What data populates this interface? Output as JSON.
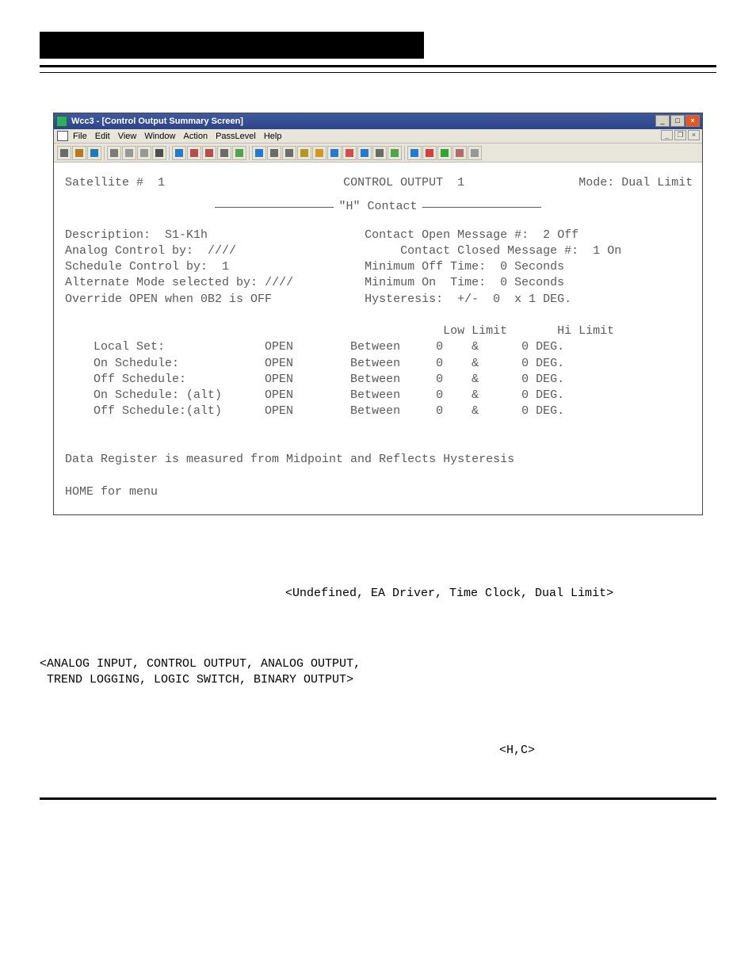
{
  "window": {
    "title": "Wcc3 - [Control Output Summary Screen]",
    "menus": [
      "File",
      "Edit",
      "View",
      "Window",
      "Action",
      "PassLevel",
      "Help"
    ],
    "mdi_buttons": {
      "min": "_",
      "restore": "❐",
      "close": "×"
    },
    "win_buttons": {
      "min": "_",
      "max": "□",
      "close": "×"
    }
  },
  "toolbar_icons": [
    "new-icon",
    "open-icon",
    "save-icon",
    "cut-icon",
    "copy-icon",
    "paste-icon",
    "print-icon",
    "help-icon",
    "book-icon",
    "book2-icon",
    "find-icon",
    "t1-icon",
    "filter-icon",
    "host-icon",
    "tree-icon",
    "hourglass-icon",
    "star-icon",
    "wand-icon",
    "gear-icon",
    "link-icon",
    "grid-icon",
    "doc-icon",
    "info-icon",
    "stop-icon",
    "play-icon",
    "person-icon",
    "tool-icon"
  ],
  "screen": {
    "satellite_label": "Satellite #",
    "satellite_no": "1",
    "control_output_label": "CONTROL OUTPUT",
    "control_output_no": "1",
    "mode_label": "Mode:",
    "mode_value": "Dual Limit",
    "h_contact": "\"H\" Contact",
    "left": {
      "description_label": "Description:",
      "description_value": "S1-K1h",
      "analog_control_label": "Analog Control by:",
      "analog_control_value": "////",
      "schedule_control_label": "Schedule Control by:",
      "schedule_control_value": "1",
      "alt_mode_label": "Alternate Mode selected by:",
      "alt_mode_value": "////",
      "override_line": "Override OPEN when 0B2 is OFF"
    },
    "right": {
      "open_msg_label": "Contact Open Message #:",
      "open_msg_no": "2",
      "open_msg_text": "Off",
      "closed_msg_label": "Contact Closed Message #:",
      "closed_msg_no": "1",
      "closed_msg_text": "On",
      "min_off_label": "Minimum Off Time:",
      "min_off_value": "0 Seconds",
      "min_on_label": "Minimum On  Time:",
      "min_on_value": "0 Seconds",
      "hyst_label": "Hysteresis:  +/-",
      "hyst_value": "0  x 1 DEG."
    },
    "limits": {
      "low_hdr": "Low Limit",
      "hi_hdr": "Hi Limit",
      "rows": [
        {
          "label": "Local Set:",
          "state": "OPEN",
          "between": "Between",
          "low": "0",
          "amp": "&",
          "hi": "0",
          "unit": "DEG."
        },
        {
          "label": "On Schedule:",
          "state": "OPEN",
          "between": "Between",
          "low": "0",
          "amp": "&",
          "hi": "0",
          "unit": "DEG."
        },
        {
          "label": "Off Schedule:",
          "state": "OPEN",
          "between": "Between",
          "low": "0",
          "amp": "&",
          "hi": "0",
          "unit": "DEG."
        },
        {
          "label": "On Schedule: (alt)",
          "state": "OPEN",
          "between": "Between",
          "low": "0",
          "amp": "&",
          "hi": "0",
          "unit": "DEG."
        },
        {
          "label": "Off Schedule:(alt)",
          "state": "OPEN",
          "between": "Between",
          "low": "0",
          "amp": "&",
          "hi": "0",
          "unit": "DEG."
        }
      ]
    },
    "note_line": "Data Register is measured from Midpoint and Reflects Hysteresis",
    "footer_line": "HOME for menu"
  },
  "below": {
    "modes_hint": "<Undefined, EA Driver, Time Clock, Dual Limit>",
    "points_hint1": "<ANALOG INPUT, CONTROL OUTPUT, ANALOG OUTPUT,",
    "points_hint2": " TREND LOGGING, LOGIC SWITCH, BINARY OUTPUT>",
    "hc_hint": "<H,C>"
  }
}
